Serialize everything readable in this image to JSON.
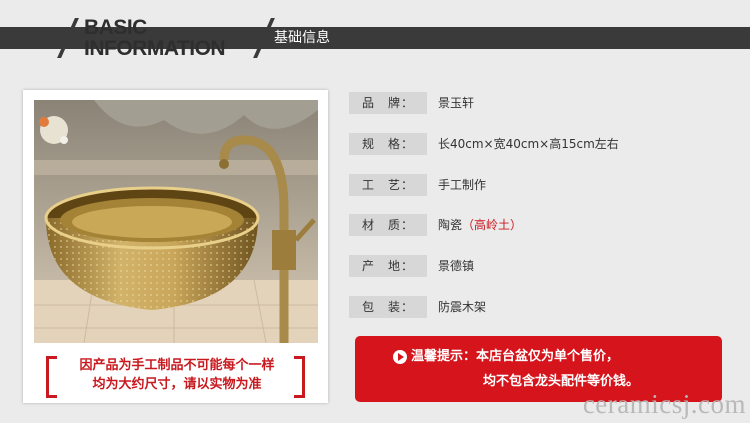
{
  "header": {
    "title_en_line1": "BASIC",
    "title_en_line2": "INFORMATION",
    "title_cn": "基础信息"
  },
  "product_image": {
    "caption_line1": "因产品为手工制品不可能每个一样",
    "caption_line2": "均为大约尺寸，请以实物为准"
  },
  "specs": [
    {
      "label": "品　牌：",
      "value": "景玉轩"
    },
    {
      "label": "规　格：",
      "value": "长40cm×宽40cm×高15cm左右"
    },
    {
      "label": "工　艺：",
      "value": "手工制作"
    },
    {
      "label": "材　质：",
      "value": "陶瓷",
      "highlight": "（高岭土）"
    },
    {
      "label": "产　地：",
      "value": "景德镇"
    },
    {
      "label": "包　装：",
      "value": "防震木架"
    }
  ],
  "notice": {
    "line1": "温馨提示：本店台盆仅为单个售价，",
    "line2": "均不包含龙头配件等价钱。"
  },
  "watermark": "ceramicsj.com",
  "colors": {
    "accent_red": "#d5141b",
    "dark_bar": "#3a3a3a",
    "label_bg": "#d7d7d7",
    "background": "#ebebeb"
  }
}
